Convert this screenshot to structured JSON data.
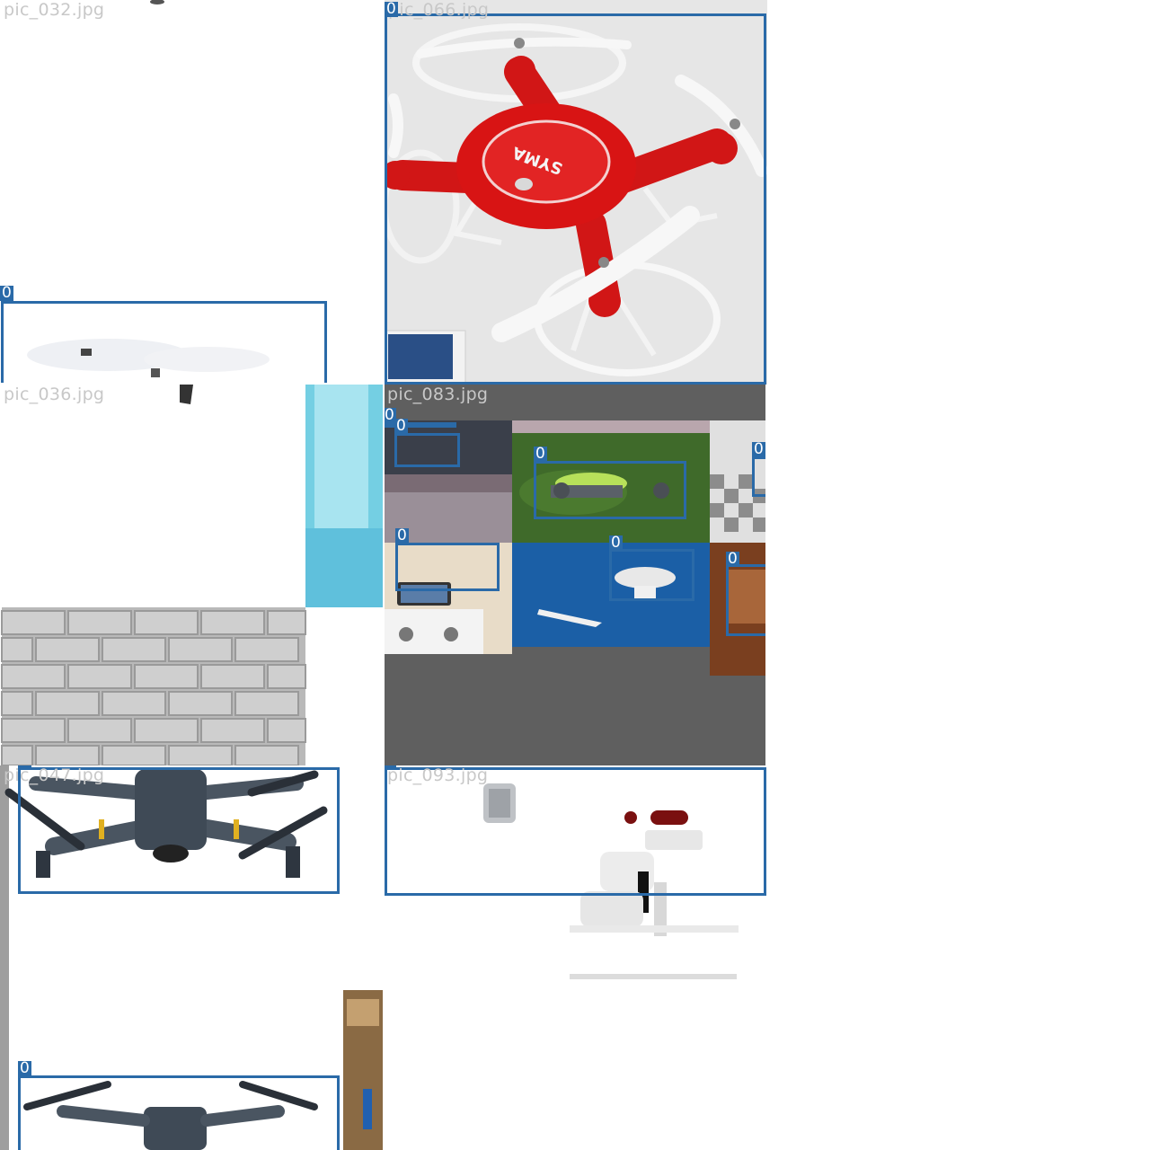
{
  "mosaic": {
    "tiles": [
      {
        "filename": "pic_032.jpg"
      },
      {
        "filename": "pic_066.jpg"
      },
      {
        "filename": "pic_036.jpg"
      },
      {
        "filename": "pic_083.jpg"
      },
      {
        "filename": "pic_047.jpg"
      },
      {
        "filename": "pic_093.jpg"
      }
    ],
    "class_label": "0",
    "brand_text": "SYMA",
    "colors": {
      "box": "#2a6aa8",
      "gray_canvas": "#5f5f5f",
      "red_drone": "#d81414",
      "filename_text": "#c8c8c8"
    }
  }
}
